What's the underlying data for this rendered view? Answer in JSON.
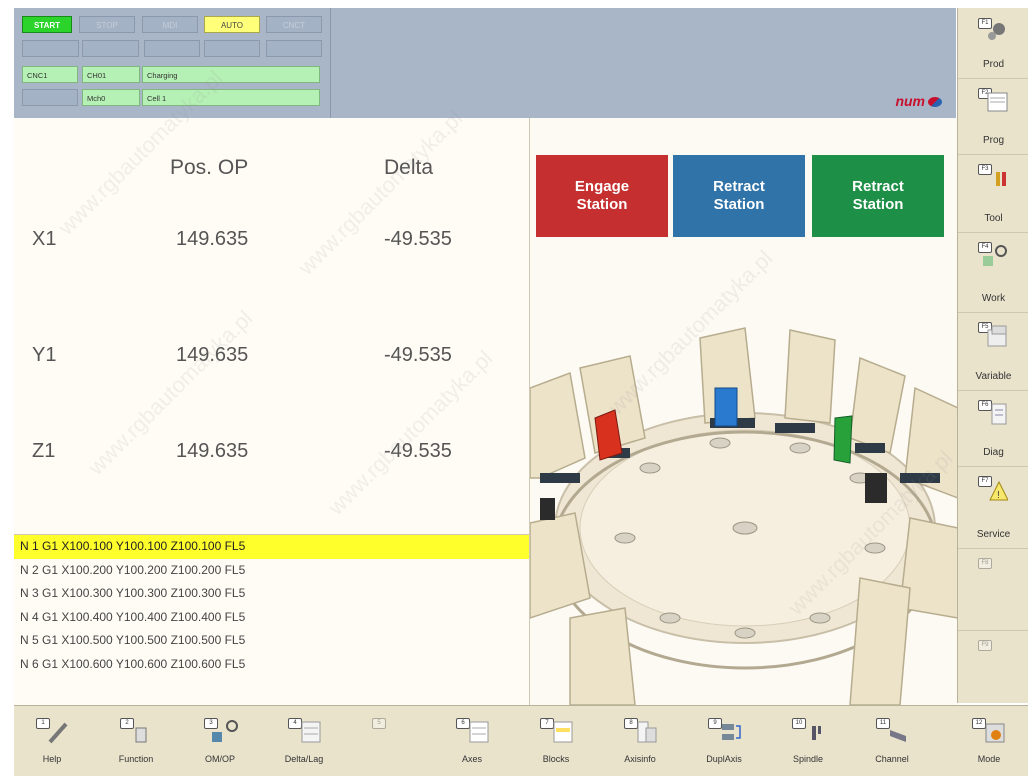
{
  "status": {
    "buttons": [
      "START",
      "STOP",
      "MDI",
      "AUTO",
      "CNCT"
    ],
    "channel_row1": [
      "CNC1",
      "CH01",
      "Charging"
    ],
    "channel_row2": [
      "",
      "Mch0",
      "Cell 1"
    ]
  },
  "brand": "num",
  "positions": {
    "header_pos": "Pos. OP",
    "header_delta": "Delta",
    "axes": [
      {
        "name": "X1",
        "pos": "149.635",
        "delta": "-49.535"
      },
      {
        "name": "Y1",
        "pos": "149.635",
        "delta": "-49.535"
      },
      {
        "name": "Z1",
        "pos": "149.635",
        "delta": "-49.535"
      }
    ]
  },
  "program": {
    "lines": [
      "N 1 G1 X100.100 Y100.100 Z100.100 FL5",
      "N 2 G1 X100.200 Y100.200 Z100.200 FL5",
      "N 3 G1 X100.300 Y100.300 Z100.300 FL5",
      "N 4 G1 X100.400 Y100.400 Z100.400 FL5",
      "N 5 G1 X100.500 Y100.500 Z100.500 FL5",
      "N 6 G1 X100.600 Y100.600 Z100.600 FL5"
    ],
    "active_line": 1
  },
  "stations": [
    {
      "line1": "Engage",
      "line2": "Station",
      "color": "#c62f2f"
    },
    {
      "line1": "Retract",
      "line2": "Station",
      "color": "#2f73a8"
    },
    {
      "line1": "Retract",
      "line2": "Station",
      "color": "#1e8f46"
    }
  ],
  "sidebar": {
    "items": [
      "Prod",
      "Prog",
      "Tool",
      "Work",
      "Variable",
      "Diag",
      "Service",
      "",
      ""
    ]
  },
  "bottombar": {
    "items": [
      "Help",
      "Function",
      "OM/OP",
      "Delta/Lag",
      "",
      "Axes",
      "Blocks",
      "Axisinfo",
      "DuplAxis",
      "Spindle",
      "Channel",
      "Mode"
    ]
  },
  "watermark": "www.rgbautomatyka.pl",
  "colors": {
    "header": "#a9b6c8",
    "start_green": "#2bd32b",
    "auto_yellow": "#ffff7a",
    "field_green": "#b5f0b5",
    "active_line_yellow": "#ffff2b",
    "menu_bg": "#e9e3cc"
  }
}
